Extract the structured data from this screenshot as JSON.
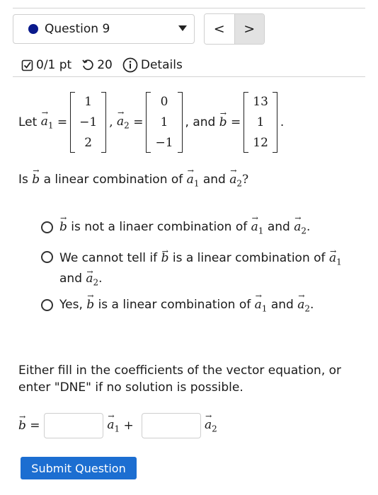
{
  "header": {
    "question_select": "Question 9",
    "prev_label": "<",
    "next_label": ">"
  },
  "meta": {
    "points": "0/1 pt",
    "attempts": "20",
    "details": "Details"
  },
  "problem": {
    "let_text": "Let",
    "vec_a": "a",
    "sub1": "1",
    "sub2": "2",
    "vec_b": "b",
    "equals": "=",
    "comma": ",",
    "and_text": ", and",
    "period": ".",
    "matrix_a1": [
      "1",
      "−1",
      "2"
    ],
    "matrix_a2": [
      "0",
      "1",
      "−1"
    ],
    "matrix_b": [
      "13",
      "1",
      "12"
    ]
  },
  "question": {
    "is": "Is",
    "text": "a linear combination of",
    "and": "and",
    "qmark": "?"
  },
  "options": [
    {
      "pre": "",
      "text": "is not a linaer combination of",
      "and": "and",
      "end": "."
    },
    {
      "pre": "We cannot tell if",
      "text": "is a linear combination of",
      "and": "and",
      "end": "."
    },
    {
      "pre": "Yes,",
      "text": "is a linear combination of",
      "and": "and",
      "end": "."
    }
  ],
  "instructions": "Either fill in the coefficients of the vector equation, or enter \"DNE\" if no solution is possible.",
  "equation": {
    "plus": "+",
    "coef1_value": "",
    "coef2_value": ""
  },
  "submit_label": "Submit Question",
  "colors": {
    "question_dot": "#0a1a8c",
    "submit_bg": "#1c6ed1"
  }
}
